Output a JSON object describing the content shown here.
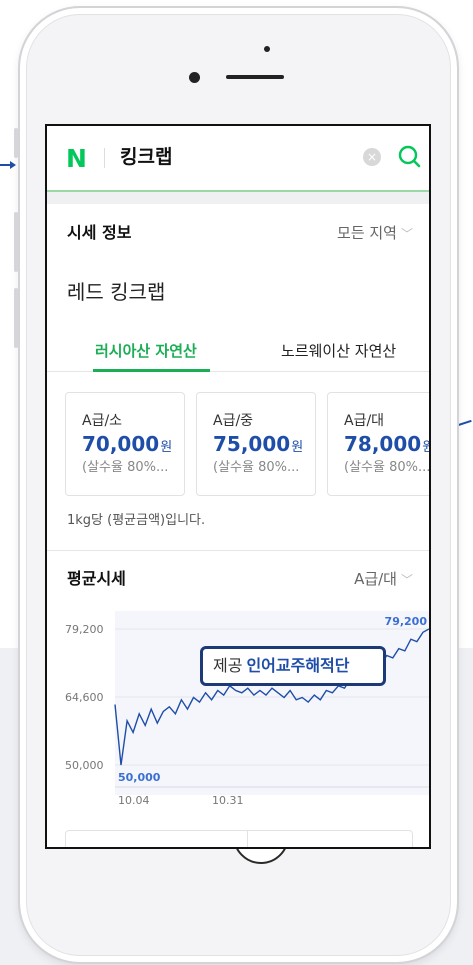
{
  "app": {
    "logo": "N",
    "query": "킹크랩",
    "clear_icon": "×"
  },
  "price_info": {
    "title": "시세 정보",
    "region": "모든 지역",
    "product": "레드 킹크랩",
    "tabs": [
      {
        "label": "러시아산 자연산",
        "active": true
      },
      {
        "label": "노르웨이산 자연산",
        "active": false
      }
    ],
    "cards": [
      {
        "grade": "A급/소",
        "price": "70,000",
        "unit": "원",
        "note": "(살수율 80%..."
      },
      {
        "grade": "A급/중",
        "price": "75,000",
        "unit": "원",
        "note": "(살수율 80%..."
      },
      {
        "grade": "A급/대",
        "price": "78,000",
        "unit": "원",
        "note": "(살수율 80%..."
      }
    ],
    "unit_note": "1kg당 (평균금액)입니다."
  },
  "avg_section": {
    "title": "평균시세",
    "grade": "A급/대"
  },
  "chart_data": {
    "type": "line",
    "y_ticks": [
      "79,200",
      "64,600",
      "50,000"
    ],
    "x_ticks": [
      "10.04",
      "10.31"
    ],
    "ylim": [
      50000,
      79200
    ],
    "max_label": "79,200",
    "min_label": "50,000",
    "series": [
      {
        "values": [
          63000,
          50000,
          59500,
          57000,
          61000,
          58500,
          62000,
          59000,
          61500,
          62500,
          61000,
          64000,
          62000,
          64500,
          63500,
          65500,
          64000,
          66000,
          65000,
          67000,
          66000,
          65500,
          66500,
          65000,
          66000,
          65000,
          66500,
          65500,
          64500,
          66000,
          64000,
          64500,
          63500,
          65000,
          64000,
          66000,
          65500,
          67000,
          66500,
          68500,
          68000,
          70000,
          69500,
          72000,
          71500,
          73500,
          73000,
          75000,
          74500,
          77000,
          76500,
          78500,
          79200
        ]
      }
    ],
    "line_color": "#1f4ea8"
  },
  "credit": {
    "prefix": "제공",
    "source": "인어교주해적단"
  }
}
